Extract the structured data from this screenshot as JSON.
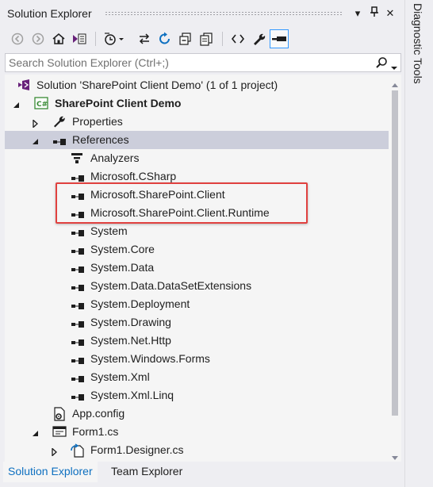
{
  "window": {
    "title": "Solution Explorer",
    "controls": {
      "dropdown": "▾",
      "pin": "⊥",
      "close": "✕"
    }
  },
  "toolbar": {
    "buttons": [
      "back-icon",
      "forward-icon",
      "home-icon",
      "switch-views-icon",
      "pending-changes-filter-icon",
      "sync-active-document-icon",
      "refresh-icon",
      "collapse-all-icon",
      "copy-icon",
      "view-code-icon",
      "properties-icon",
      "preview-selected-items-icon"
    ]
  },
  "search": {
    "placeholder": "Search Solution Explorer (Ctrl+;)"
  },
  "tree": {
    "items": [
      {
        "label": "Solution 'SharePoint Client Demo' (1 of 1 project)",
        "icon": "solution-icon",
        "expander": "none",
        "bold": false
      },
      {
        "label": "SharePoint Client Demo",
        "icon": "csharp-project-icon",
        "expander": "expanded",
        "bold": true
      },
      {
        "label": "Properties",
        "icon": "wrench-icon",
        "expander": "collapsed",
        "bold": false
      },
      {
        "label": "References",
        "icon": "references-icon",
        "expander": "expanded",
        "bold": false,
        "selected": true
      },
      {
        "label": "Analyzers",
        "icon": "analyzers-icon",
        "expander": "none",
        "bold": false
      },
      {
        "label": "Microsoft.CSharp",
        "icon": "reference-icon",
        "expander": "none",
        "bold": false
      },
      {
        "label": "Microsoft.SharePoint.Client",
        "icon": "reference-icon",
        "expander": "none",
        "bold": false
      },
      {
        "label": "Microsoft.SharePoint.Client.Runtime",
        "icon": "reference-icon",
        "expander": "none",
        "bold": false
      },
      {
        "label": "System",
        "icon": "reference-icon",
        "expander": "none",
        "bold": false
      },
      {
        "label": "System.Core",
        "icon": "reference-icon",
        "expander": "none",
        "bold": false
      },
      {
        "label": "System.Data",
        "icon": "reference-icon",
        "expander": "none",
        "bold": false
      },
      {
        "label": "System.Data.DataSetExtensions",
        "icon": "reference-icon",
        "expander": "none",
        "bold": false
      },
      {
        "label": "System.Deployment",
        "icon": "reference-icon",
        "expander": "none",
        "bold": false
      },
      {
        "label": "System.Drawing",
        "icon": "reference-icon",
        "expander": "none",
        "bold": false
      },
      {
        "label": "System.Net.Http",
        "icon": "reference-icon",
        "expander": "none",
        "bold": false
      },
      {
        "label": "System.Windows.Forms",
        "icon": "reference-icon",
        "expander": "none",
        "bold": false
      },
      {
        "label": "System.Xml",
        "icon": "reference-icon",
        "expander": "none",
        "bold": false
      },
      {
        "label": "System.Xml.Linq",
        "icon": "reference-icon",
        "expander": "none",
        "bold": false
      },
      {
        "label": "App.config",
        "icon": "config-file-icon",
        "expander": "none",
        "bold": false
      },
      {
        "label": "Form1.cs",
        "icon": "form-icon",
        "expander": "expanded",
        "bold": false
      },
      {
        "label": "Form1.Designer.cs",
        "icon": "designer-file-icon",
        "expander": "collapsed",
        "bold": false
      }
    ]
  },
  "tabs": {
    "solution_explorer": "Solution Explorer",
    "team_explorer": "Team Explorer"
  },
  "side_panel": {
    "label": "Diagnostic Tools"
  },
  "colors": {
    "accent": "#0e70c0",
    "selection": "#cccedb",
    "highlight_box": "#e0413f",
    "csharp_green": "#388a34"
  }
}
